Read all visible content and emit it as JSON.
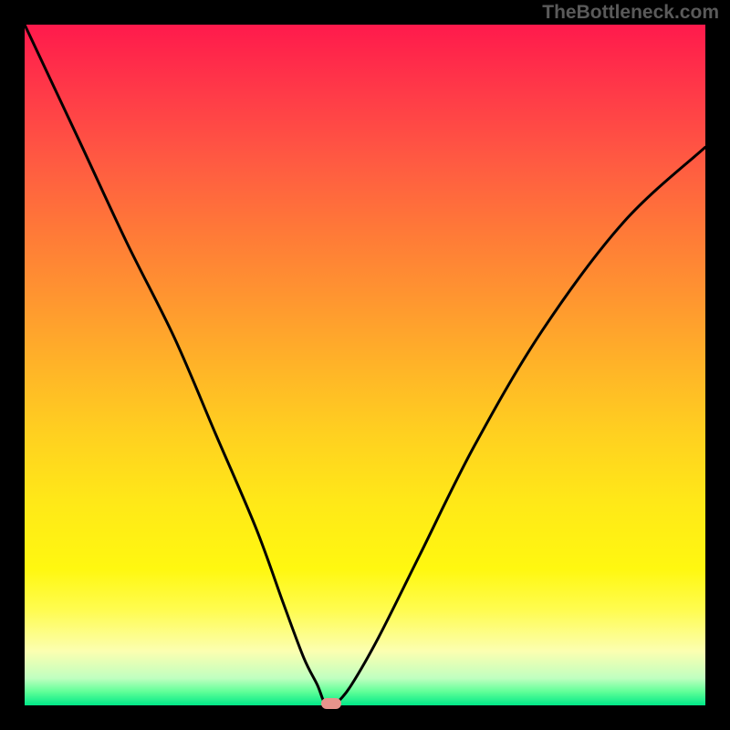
{
  "watermark": "TheBottleneck.com",
  "chart_data": {
    "type": "line",
    "title": "",
    "xlabel": "",
    "ylabel": "",
    "xlim": [
      0,
      100
    ],
    "ylim": [
      0,
      100
    ],
    "background": "spectral-gradient",
    "curve": {
      "description": "V-shaped bottleneck curve",
      "x": [
        0,
        8,
        15,
        22,
        28,
        34,
        38,
        41,
        43,
        44,
        45,
        46,
        48,
        52,
        58,
        66,
        76,
        88,
        100
      ],
      "y": [
        100,
        83,
        68,
        54,
        40,
        26,
        15,
        7,
        3,
        0.5,
        0,
        0.5,
        3,
        10,
        22,
        38,
        55,
        71,
        82
      ],
      "minimum_x": 45,
      "minimum_y": 0
    },
    "marker": {
      "x": 45,
      "y": 0.3,
      "color": "#e8948c"
    }
  }
}
